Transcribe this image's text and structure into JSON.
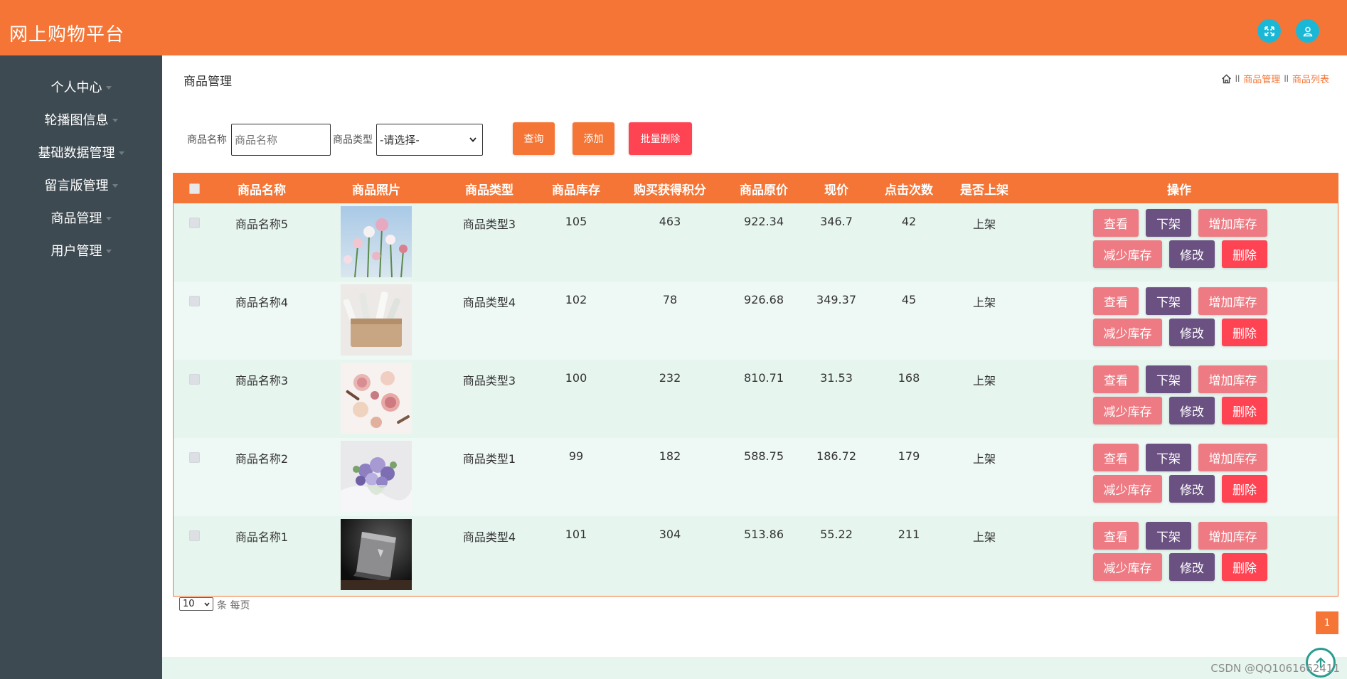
{
  "app": {
    "title": "网上购物平台"
  },
  "header_icons": [
    "fullscreen-icon",
    "user-icon"
  ],
  "sidebar": {
    "items": [
      {
        "label": "个人中心"
      },
      {
        "label": "轮播图信息"
      },
      {
        "label": "基础数据管理"
      },
      {
        "label": "留言版管理"
      },
      {
        "label": "商品管理"
      },
      {
        "label": "用户管理"
      }
    ]
  },
  "page": {
    "title": "商品管理",
    "breadcrumb": [
      "商品管理",
      "商品列表"
    ]
  },
  "search": {
    "name_label": "商品名称",
    "name_placeholder": "商品名称",
    "type_label": "商品类型",
    "type_selected": "-请选择-",
    "query_button": "查询",
    "add_button": "添加",
    "batch_delete_button": "批量删除"
  },
  "table": {
    "columns": [
      "商品名称",
      "商品照片",
      "商品类型",
      "商品库存",
      "购买获得积分",
      "商品原价",
      "现价",
      "点击次数",
      "是否上架",
      "操作"
    ],
    "actions": {
      "view": "查看",
      "off_shelf": "下架",
      "add_stock": "增加库存",
      "reduce_stock": "减少库存",
      "edit": "修改",
      "delete": "删除"
    },
    "rows": [
      {
        "name": "商品名称5",
        "type": "商品类型3",
        "stock": "105",
        "points": "463",
        "original_price": "922.34",
        "price": "346.7",
        "clicks": "42",
        "on_shelf": "上架"
      },
      {
        "name": "商品名称4",
        "type": "商品类型4",
        "stock": "102",
        "points": "78",
        "original_price": "926.68",
        "price": "349.37",
        "clicks": "45",
        "on_shelf": "上架"
      },
      {
        "name": "商品名称3",
        "type": "商品类型3",
        "stock": "100",
        "points": "232",
        "original_price": "810.71",
        "price": "31.53",
        "clicks": "168",
        "on_shelf": "上架"
      },
      {
        "name": "商品名称2",
        "type": "商品类型1",
        "stock": "99",
        "points": "182",
        "original_price": "588.75",
        "price": "186.72",
        "clicks": "179",
        "on_shelf": "上架"
      },
      {
        "name": "商品名称1",
        "type": "商品类型4",
        "stock": "101",
        "points": "304",
        "original_price": "513.86",
        "price": "55.22",
        "clicks": "211",
        "on_shelf": "上架"
      }
    ]
  },
  "pagination": {
    "page_size": "10",
    "page_size_suffix": "条 每页",
    "current_page": "1"
  },
  "watermark": "CSDN @QQ1061662411",
  "colors": {
    "primary": "#f47535",
    "sidebar": "#3e4a51",
    "header_icon": "#1ab8d6",
    "action_pink": "#ee7b83",
    "action_purple": "#6a5181",
    "action_red": "#fe4353"
  }
}
